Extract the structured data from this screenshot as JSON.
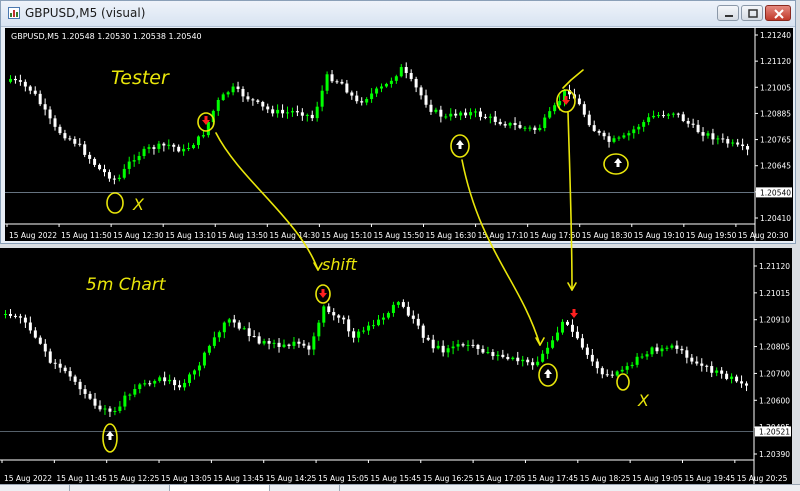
{
  "window": {
    "title": "GBPUSD,M5 (visual)",
    "buttons": [
      "minimize-button",
      "maximize-button",
      "close-button"
    ]
  },
  "top_chart": {
    "symbol_line": "GBPUSD,M5  1.20548 1.20530 1.20538 1.20540",
    "price_labels": [
      "1.21240",
      "1.21120",
      "1.21005",
      "1.20885",
      "1.20765",
      "1.20645",
      "1.20530",
      "1.20410"
    ],
    "current_price": "1.20540",
    "time_labels": [
      "15 Aug 2022",
      "15 Aug 11:50",
      "15 Aug 12:30",
      "15 Aug 13:10",
      "15 Aug 13:50",
      "15 Aug 14:30",
      "15 Aug 15:10",
      "15 Aug 15:50",
      "15 Aug 16:30",
      "15 Aug 17:10",
      "15 Aug 17:50",
      "15 Aug 18:30",
      "15 Aug 19:10",
      "15 Aug 19:50",
      "15 Aug 20:30"
    ],
    "annotations": {
      "title": "Tester",
      "x_mark": "X"
    }
  },
  "bottom_chart": {
    "price_labels": [
      "1.21120",
      "1.21015",
      "1.20910",
      "1.20805",
      "1.20700",
      "1.20600",
      "1.20495",
      "1.20390"
    ],
    "current_price": "1.20521",
    "time_labels": [
      "15 Aug 2022",
      "15 Aug 11:45",
      "15 Aug 12:25",
      "15 Aug 13:05",
      "15 Aug 13:45",
      "15 Aug 14:25",
      "15 Aug 15:05",
      "15 Aug 15:45",
      "15 Aug 16:25",
      "15 Aug 17:05",
      "15 Aug 17:45",
      "15 Aug 18:25",
      "15 Aug 19:05",
      "15 Aug 19:45",
      "15 Aug 20:25"
    ],
    "annotations": {
      "title": "5m Chart",
      "shift_label": "shift",
      "x_mark": "X"
    }
  },
  "colors": {
    "bull": "#00ff00",
    "bear": "#ffffff",
    "background": "#000000",
    "annotation": "#e9e60a",
    "signal_arrow": "#ff2020",
    "up_arrow": "#ffffff"
  }
}
